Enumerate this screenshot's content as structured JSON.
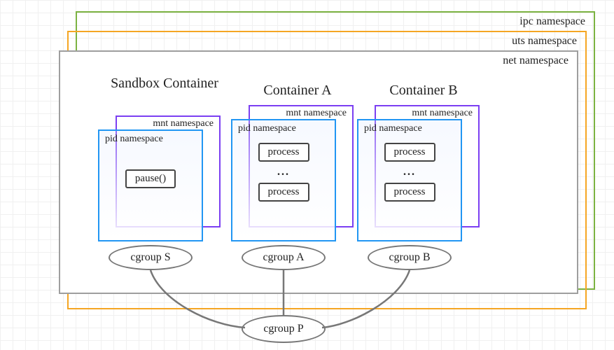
{
  "namespaces": {
    "ipc": "ipc namespace",
    "uts": "uts namespace",
    "net": "net namespace",
    "mnt": "mnt namespace",
    "pid": "pid namespace"
  },
  "containers": {
    "sandbox": {
      "title": "Sandbox Container",
      "pause": "pause()"
    },
    "a": {
      "title": "Container A",
      "process": "process",
      "dots": "..."
    },
    "b": {
      "title": "Container B",
      "process": "process",
      "dots": "..."
    }
  },
  "cgroups": {
    "s": "cgroup S",
    "a": "cgroup A",
    "b": "cgroup B",
    "p": "cgroup P"
  }
}
